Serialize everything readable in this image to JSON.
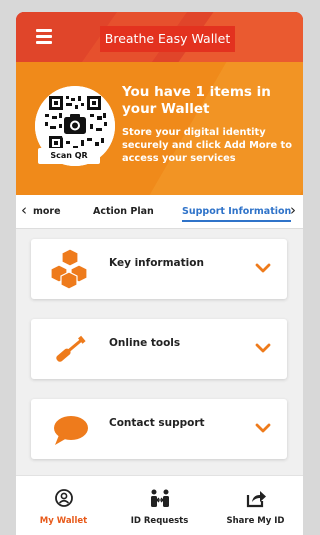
{
  "header": {
    "title": "Breathe Easy Wallet",
    "menu_icon": "hamburger-menu-icon"
  },
  "hero": {
    "scan_label": "Scan QR",
    "title": "You have 1 items in your Wallet",
    "subtitle": "Store your digital identity securely and click Add More to access your services",
    "icon": "camera-icon"
  },
  "tabs": [
    {
      "label": "more"
    },
    {
      "label": "Action Plan"
    },
    {
      "label": "Support Information",
      "active": true
    }
  ],
  "cards": [
    {
      "label": "Key information",
      "icon": "boxes-icon"
    },
    {
      "label": "Online tools",
      "icon": "wrench-icon"
    },
    {
      "label": "Contact support",
      "icon": "speech-bubble-icon"
    }
  ],
  "bottom_nav": [
    {
      "label": "My Wallet",
      "icon": "wallet-icon",
      "active": true
    },
    {
      "label": "ID Requests",
      "icon": "id-exchange-icon"
    },
    {
      "label": "Share My ID",
      "icon": "share-icon"
    }
  ],
  "colors": {
    "brand_red": "#cf1638",
    "header_orange_red": "#e0452a",
    "hero_orange": "#f08a1a",
    "accent_orange": "#e8741a",
    "active_tab_blue": "#2f73c9"
  }
}
